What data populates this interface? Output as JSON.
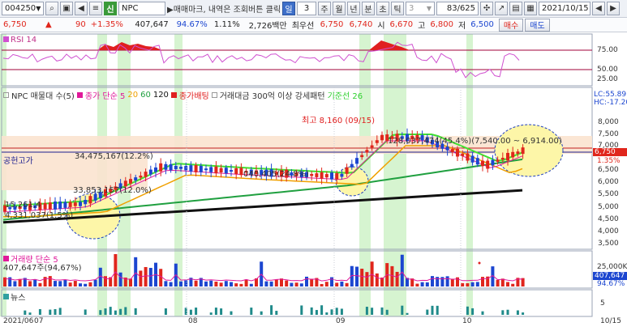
{
  "toolbar": {
    "code": "004250",
    "name": "NPC",
    "tag": "신",
    "hint": "매매마크, 내역은 조회버튼 클릭",
    "period_selected": "일",
    "period_count": "3",
    "periods": [
      "주",
      "월",
      "년",
      "분",
      "초",
      "틱"
    ],
    "tick_count": "3",
    "counter": "83/625",
    "date": "2021/10/15"
  },
  "quote": {
    "price": "6,750",
    "change": "90",
    "change_pct": "+1.35%",
    "volume": "407,647",
    "vol_ratio": "94.67%",
    "turnover": "1.11%",
    "amount": "2,726백만",
    "priority_label": "최우선",
    "ask": "6,750",
    "bid": "6,740",
    "open_label": "시",
    "open": "6,670",
    "high_label": "고",
    "high": "6,800",
    "low_label": "저",
    "low": "6,500",
    "buy_label": "매수",
    "sell_label": "매도"
  },
  "panels": {
    "rsi_title": "RSI 14",
    "price_legend": [
      "NPC 매물대 수(5)",
      "종가 단순 5",
      "20",
      "60",
      "120",
      "종가배팅",
      "거래대금 300억 이상 강세패턴",
      "기준선 26"
    ],
    "volume_title": "거래량 단순 5",
    "volume_value": "407,647주(94,67%)",
    "news_title": "뉴스"
  },
  "price_annotations": {
    "max_label": "최고 8,160 (09/15)",
    "range_label": "128,037,474(45.4%)(7,540.00 ~ 6,914.00)",
    "band1": "34,475,167(12.2%)",
    "band2": "040,405(24.8%)",
    "band3": "33,853,157(12.0%)",
    "band4": "15,261,4",
    "band5": "4,331,037(1.5%)",
    "left_label": "공헌고가",
    "lc": "LC:55.89",
    "hc": "HC:-17.20",
    "current_price": "6,750",
    "current_pct": "1.35%"
  },
  "axes": {
    "rsi_ticks": [
      "75.00",
      "50.00",
      "25.00"
    ],
    "price_ticks": [
      "8,000",
      "7,500",
      "7,000",
      "6,500",
      "6,000",
      "5,500",
      "5,000",
      "4,500",
      "4,000",
      "3,500"
    ],
    "volume_ticks": [
      "25,000K",
      "407,647",
      "94.67%"
    ],
    "news_ticks": [
      "5"
    ],
    "x_labels": [
      "2021/06",
      "07",
      "08",
      "09",
      "10",
      "10/15"
    ]
  },
  "colors": {
    "up": "#e0261c",
    "down": "#1c46d0",
    "ma5": "#e0199a",
    "ma20": "#f0a000",
    "ma60": "#20a040",
    "ma120": "#111111",
    "green_band": "#c8f0c0",
    "zone": "#fbe3cf"
  }
}
